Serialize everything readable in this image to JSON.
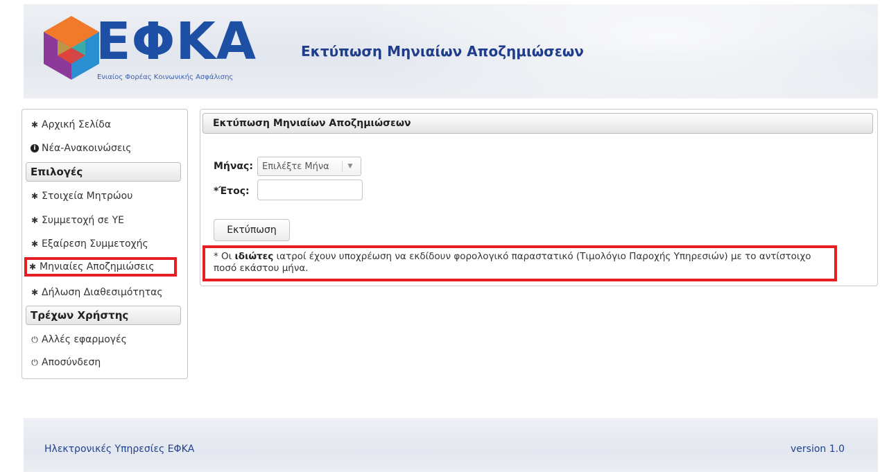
{
  "header": {
    "logo_text": "ΕΦΚΑ",
    "logo_subtitle": "Ενιαίος Φορέας Κοινωνικής Ασφάλισης",
    "title": "Εκτύπωση Μηνιαίων Αποζημιώσεων"
  },
  "sidebar": {
    "items_top": [
      {
        "label": "Αρχική Σελίδα",
        "icon": "gear-icon"
      },
      {
        "label": "Νέα-Ανακοινώσεις",
        "icon": "info-icon"
      }
    ],
    "section_options": "Επιλογές",
    "items_options": [
      {
        "label": "Στοιχεία Μητρώου",
        "icon": "gear-icon"
      },
      {
        "label": "Συμμετοχή σε ΥΕ",
        "icon": "gear-icon"
      },
      {
        "label": "Εξαίρεση Συμμετοχής",
        "icon": "gear-icon"
      },
      {
        "label": "Μηνιαίες Αποζημιώσεις",
        "icon": "gear-icon"
      },
      {
        "label": "Δήλωση Διαθεσιμότητας",
        "icon": "gear-icon"
      }
    ],
    "section_user": "Τρέχων Χρήστης",
    "items_user": [
      {
        "label": "Αλλές εφαρμογές",
        "icon": "power-icon"
      },
      {
        "label": "Αποσύνδεση",
        "icon": "power-icon"
      }
    ]
  },
  "panel": {
    "title": "Εκτύπωση Μηνιαίων Αποζημιώσεων",
    "month_label": "Μήνας:",
    "month_select": "Επιλέξτε Μήνα",
    "year_label": "*Έτος:",
    "year_value": "",
    "print_button": "Εκτύπωση",
    "note_prefix": "* Οι ",
    "note_bold": "ιδιώτες",
    "note_rest": " ιατροί έχουν υποχρέωση να εκδίδουν φορολογικό παραστατικό (Τιμολόγιο Παροχής Υπηρεσιών) με το αντίστοιχο ποσό εκάστου μήνα."
  },
  "footer": {
    "left": "Ηλεκτρονικές Υπηρεσίες ΕΦΚΑ",
    "right": "version 1.0"
  },
  "colors": {
    "highlight": "#e51e25",
    "brand_blue": "#1d4fa5"
  }
}
